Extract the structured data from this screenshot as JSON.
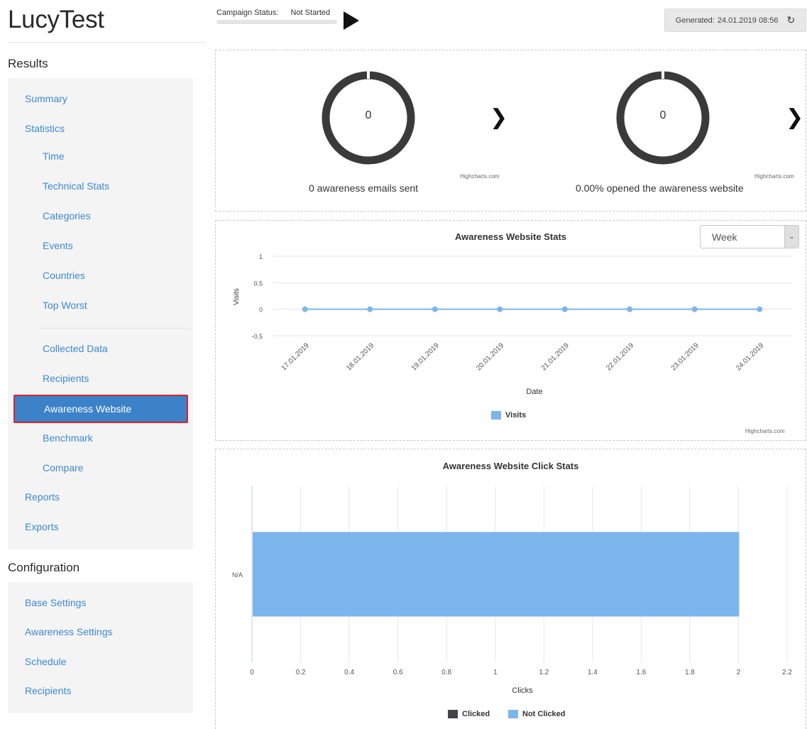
{
  "app": {
    "title": "LucyTest"
  },
  "status": {
    "label": "Campaign Status:",
    "value": "Not Started",
    "generated_label": "Generated:",
    "generated_value": "24.01.2019 08:56",
    "refresh_icon": "refresh-icon"
  },
  "sidebar": {
    "results_heading": "Results",
    "results_items": [
      {
        "label": "Summary"
      },
      {
        "label": "Statistics"
      },
      {
        "label": "Time"
      },
      {
        "label": "Technical Stats"
      },
      {
        "label": "Categories"
      },
      {
        "label": "Events"
      },
      {
        "label": "Countries"
      },
      {
        "label": "Top Worst"
      },
      {
        "label": "Collected Data"
      },
      {
        "label": "Recipients"
      },
      {
        "label": "Awareness Website",
        "active": true
      },
      {
        "label": "Benchmark"
      },
      {
        "label": "Compare"
      },
      {
        "label": "Reports"
      },
      {
        "label": "Exports"
      }
    ],
    "config_heading": "Configuration",
    "config_items": [
      {
        "label": "Base Settings"
      },
      {
        "label": "Awareness Settings"
      },
      {
        "label": "Schedule"
      },
      {
        "label": "Recipients"
      }
    ]
  },
  "colors": {
    "link": "#3d8ad4",
    "active_bg": "#3b82c8",
    "active_border": "#e0202a",
    "series_blue": "#7cb5ec",
    "series_dark": "#434348",
    "donut_ring": "#3a3a3a"
  },
  "summary": {
    "emails": {
      "value": "0",
      "caption": "0 awareness emails sent",
      "credit": "Highcharts.com"
    },
    "opened": {
      "value": "0",
      "caption": "0.00% opened the awareness website",
      "credit": "Highcharts.com"
    }
  },
  "chart_data": [
    {
      "type": "line",
      "title": "Awareness Website Stats",
      "xlabel": "Date",
      "ylabel": "Visits",
      "x": [
        "17.01.2019",
        "18.01.2019",
        "19.01.2019",
        "20.01.2019",
        "21.01.2019",
        "22.01.2019",
        "23.01.2019",
        "24.01.2019"
      ],
      "yticks": [
        "1",
        "0.5",
        "0",
        "-0.5"
      ],
      "ylim": [
        -0.5,
        1
      ],
      "series": [
        {
          "name": "Visits",
          "values": [
            0,
            0,
            0,
            0,
            0,
            0,
            0,
            0
          ],
          "color": "#7cb5ec"
        }
      ],
      "legend": "bottom-center",
      "grid": true,
      "period_select": {
        "value": "Week"
      },
      "credit": "Highcharts.com"
    },
    {
      "type": "bar",
      "orientation": "horizontal",
      "title": "Awareness Website Click Stats",
      "xlabel": "Clicks",
      "categories": [
        "N/A"
      ],
      "xticks": [
        "0",
        "0.2",
        "0.4",
        "0.6",
        "0.8",
        "1",
        "1.2",
        "1.4",
        "1.6",
        "1.8",
        "2",
        "2.2"
      ],
      "xlim": [
        0,
        2.2
      ],
      "series": [
        {
          "name": "Clicked",
          "values": [
            0
          ],
          "color": "#434348"
        },
        {
          "name": "Not Clicked",
          "values": [
            2
          ],
          "color": "#7cb5ec"
        }
      ],
      "legend": "bottom-center",
      "grid": true
    }
  ]
}
